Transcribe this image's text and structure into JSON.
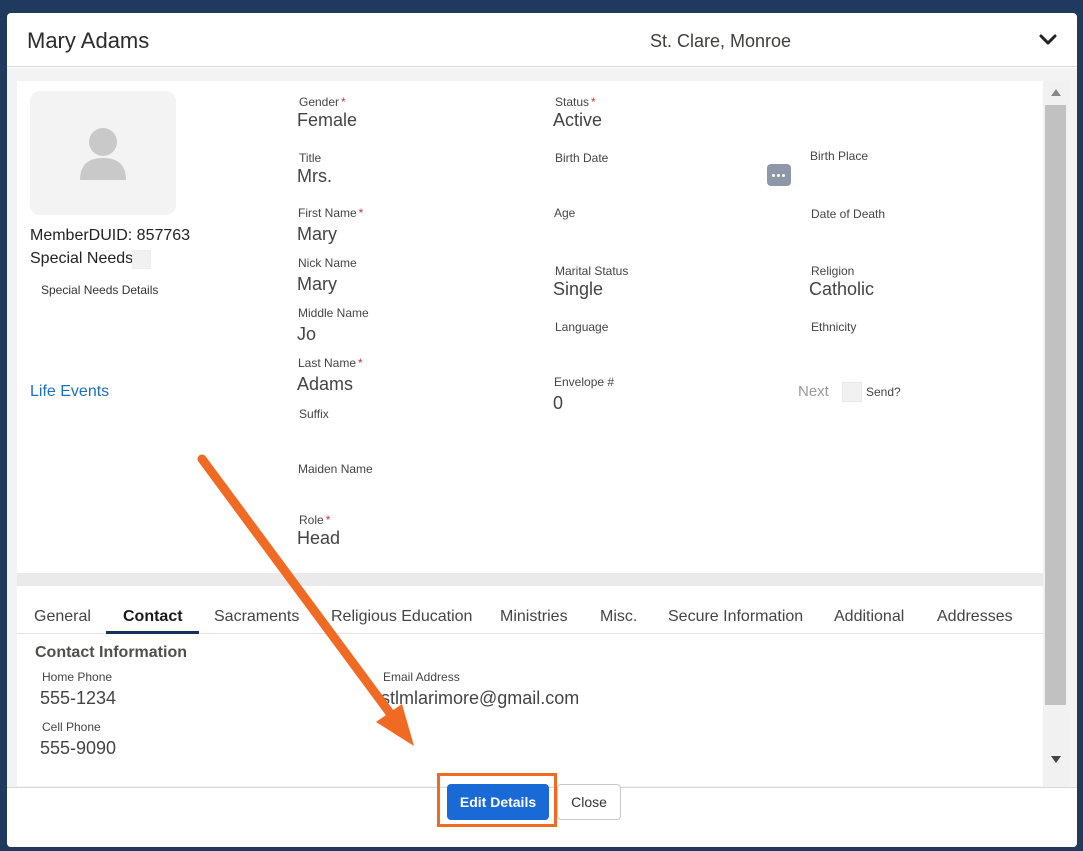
{
  "header": {
    "title": "Mary Adams",
    "parish": "St. Clare, Monroe"
  },
  "profile": {
    "member_id_text": "MemberDUID: 857763",
    "special_needs_label": "Special Needs",
    "special_needs_details_label": "Special Needs Details",
    "life_events_link": "Life Events"
  },
  "fields": {
    "gender": {
      "label": "Gender",
      "required": "*",
      "value": "Female"
    },
    "status": {
      "label": "Status",
      "required": "*",
      "value": "Active"
    },
    "title": {
      "label": "Title",
      "value": "Mrs."
    },
    "birth_date": {
      "label": "Birth Date"
    },
    "birth_place": {
      "label": "Birth Place"
    },
    "first_name": {
      "label": "First Name",
      "required": "*",
      "value": "Mary"
    },
    "age": {
      "label": "Age"
    },
    "date_of_death": {
      "label": "Date of Death"
    },
    "nick_name": {
      "label": "Nick Name",
      "value": "Mary"
    },
    "marital_status": {
      "label": "Marital Status",
      "value": "Single"
    },
    "religion": {
      "label": "Religion",
      "value": "Catholic"
    },
    "middle_name": {
      "label": "Middle Name",
      "value": "Jo"
    },
    "language": {
      "label": "Language"
    },
    "ethnicity": {
      "label": "Ethnicity"
    },
    "last_name": {
      "label": "Last Name",
      "required": "*",
      "value": "Adams"
    },
    "envelope": {
      "label": "Envelope #",
      "value": "0"
    },
    "suffix": {
      "label": "Suffix"
    },
    "maiden_name": {
      "label": "Maiden Name"
    },
    "role": {
      "label": "Role",
      "required": "*",
      "value": "Head"
    }
  },
  "envelope_extra": {
    "next_label": "Next",
    "send_label": "Send?"
  },
  "tabs": [
    {
      "label": "General"
    },
    {
      "label": "Contact"
    },
    {
      "label": "Sacraments"
    },
    {
      "label": "Religious Education"
    },
    {
      "label": "Ministries"
    },
    {
      "label": "Misc."
    },
    {
      "label": "Secure Information"
    },
    {
      "label": "Additional"
    },
    {
      "label": "Addresses"
    }
  ],
  "active_tab": "Contact",
  "contact": {
    "section_title": "Contact Information",
    "home_phone": {
      "label": "Home Phone",
      "value": "555-1234"
    },
    "email": {
      "label": "Email Address",
      "value": "stlmlarimore@gmail.com"
    },
    "cell_phone": {
      "label": "Cell Phone",
      "value": "555-9090"
    }
  },
  "footer": {
    "edit_label": "Edit Details",
    "close_label": "Close"
  },
  "colors": {
    "accent_blue": "#1a6ad6",
    "link_blue": "#1b6fc2",
    "annotation_orange": "#f06a24",
    "required_red": "#c23934",
    "tab_underline": "#16325c"
  },
  "icons": {
    "collapse": "chevron-down-icon",
    "avatar": "person-icon",
    "birth_date_picker": "more-dots-icon"
  }
}
